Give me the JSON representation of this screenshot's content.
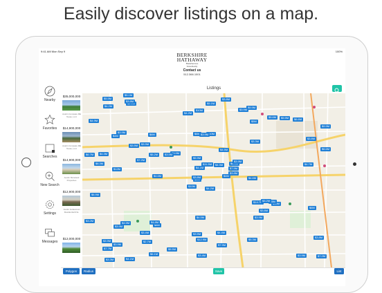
{
  "headline": "Easily discover listings on a map.",
  "status": {
    "time": "9:41 AM  Mon Sep 9",
    "battery": "100%"
  },
  "brand": {
    "line1": "BERKSHIRE",
    "line2": "HATHAWAY",
    "line3": "HomeServices",
    "line4": "Texas Realty",
    "contact_label": "Contact us",
    "phone": "512.366.1001"
  },
  "nav": [
    {
      "label": "Nearby",
      "icon": "compass-icon"
    },
    {
      "label": "Favorites",
      "icon": "star-icon"
    },
    {
      "label": "Searches",
      "icon": "folder-icon"
    },
    {
      "label": "New Search",
      "icon": "zoom-plus-icon"
    },
    {
      "label": "Settings",
      "icon": "gear-icon"
    },
    {
      "label": "Messages",
      "icon": "chat-icon"
    }
  ],
  "listings_title": "Listings",
  "list": [
    {
      "price": "$35,000,000",
      "company": "Austin Compass RE Texas, LLC"
    },
    {
      "price": "$14,900,000",
      "company": "Austin Compass RE Texas, LLC"
    },
    {
      "price": "$14,900,000",
      "company": "Austin Moreland Properties"
    },
    {
      "price": "$12,900,000",
      "company": "Austin Gottesman Residential R.E."
    },
    {
      "price": "$12,000,000",
      "company": ""
    }
  ],
  "pins": [
    "$4.2M",
    "$4M",
    "$4M",
    "$6.6M",
    "$6.5M",
    "$8M",
    "$9.9M",
    "$10M",
    "$5M",
    "$4M",
    "$4.6M",
    "$7.2M",
    "$12M",
    "$9.9M",
    "$10M",
    "$3.3M",
    "$4.1M",
    "$6M",
    "$4.5M",
    "$4.5M",
    "$6.9M",
    "$7.7M",
    "$2.7M",
    "$3.9M",
    "$3.9M",
    "$14M",
    "$3.9M",
    "$10M",
    "$8.3M",
    "$14.7M",
    "$6.6M",
    "$3.8M",
    "$3.5M",
    "$4.1M",
    "$6M",
    "$5.6M",
    "$4.8M",
    "$3.9M",
    "$3.8M",
    "$5M",
    "$3.8M",
    "$3.5M",
    "$7.2M",
    "$3.9M",
    "$6.1M",
    "$6.7M",
    "$7.5M",
    "$3.3M",
    "$12.9M",
    "$3.8M",
    "$3.9M",
    "$3.8M",
    "$4.9M",
    "$3.8M",
    "$5.3M",
    "$3.4M",
    "$3.8M",
    "$5.5M",
    "$4.4M",
    "$6.6M",
    "$5.1M",
    "$4.6M",
    "$4.3M",
    "$3.9M",
    "$5.5M",
    "$5.1M",
    "$3.9M",
    "$4.2M",
    "$11.5M",
    "$3.2M",
    "$4.5M",
    "$5.5M",
    "$3.2M",
    "$5.2M",
    "$3.9M",
    "$4.2M",
    "$3.5M",
    "$6.9M",
    "$5.9M",
    "$7.9M",
    "$4.3M",
    "$3.9M",
    "$4.6M",
    "$6M",
    "$3.4M",
    "$4.7M"
  ],
  "bottom": {
    "polygon": "Polygon",
    "radius": "Radius",
    "save": "Save",
    "list": "List"
  }
}
